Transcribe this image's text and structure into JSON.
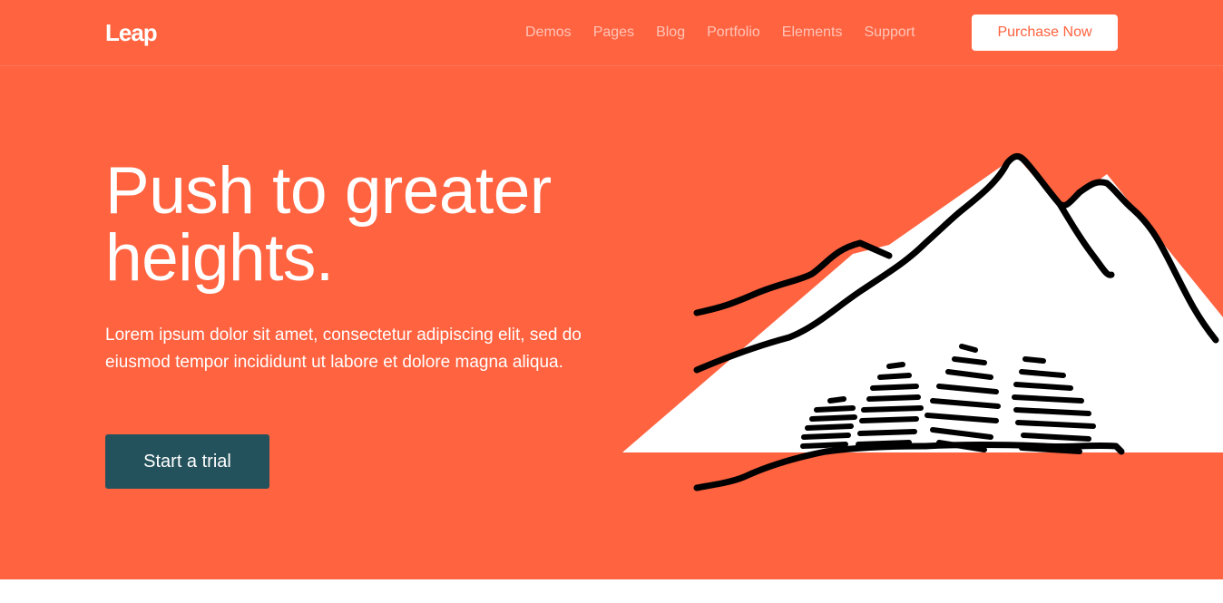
{
  "brand": {
    "logo": "Leap"
  },
  "nav": {
    "items": [
      "Demos",
      "Pages",
      "Blog",
      "Portfolio",
      "Elements",
      "Support"
    ],
    "purchase_label": "Purchase Now"
  },
  "hero": {
    "title_line1": "Push to greater",
    "title_line2": "heights.",
    "body": "Lorem ipsum dolor sit amet, consectetur adipiscing elit, sed do eiusmod tempor incididunt ut labore et dolore magna aliqua.",
    "cta_label": "Start a trial"
  },
  "colors": {
    "hero_bg": "#ff6340",
    "cta_bg": "#24525c",
    "text": "#ffffff"
  },
  "icons": {
    "illustration": "mountain-illustration"
  }
}
